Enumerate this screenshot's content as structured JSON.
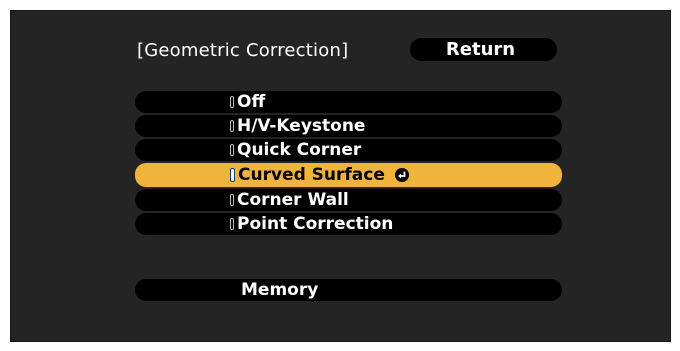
{
  "header": {
    "title": "[Geometric Correction]",
    "return_label": "Return"
  },
  "menu": {
    "items": [
      {
        "label": "Off",
        "selected": false
      },
      {
        "label": "H/V-Keystone",
        "selected": false
      },
      {
        "label": "Quick Corner",
        "selected": false
      },
      {
        "label": "Curved Surface",
        "selected": true,
        "icon": "enter-icon"
      },
      {
        "label": "Corner Wall",
        "selected": false
      },
      {
        "label": "Point Correction",
        "selected": false
      }
    ]
  },
  "memory": {
    "label": "Memory"
  },
  "colors": {
    "background": "#242424",
    "item": "#000000",
    "selected": "#f0b43c",
    "text": "#ffffff"
  }
}
